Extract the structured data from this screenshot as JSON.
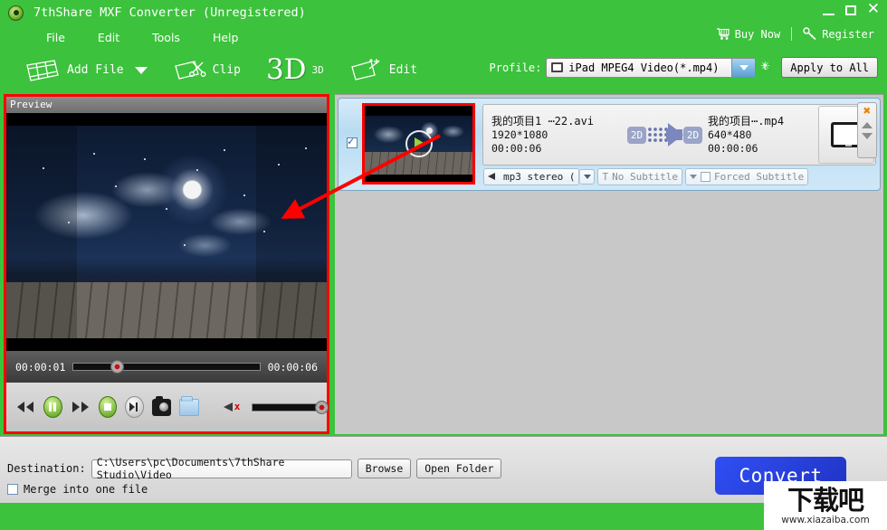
{
  "window": {
    "title": "7thShare MXF Converter (Unregistered)",
    "app_icon": "app-logo-icon",
    "minimize": "—",
    "maximize": "□",
    "close": "✕",
    "title_bar_color": "#3cc23c"
  },
  "menubar": {
    "items": [
      {
        "label": "File"
      },
      {
        "label": "Edit"
      },
      {
        "label": "Tools"
      },
      {
        "label": "Help"
      }
    ]
  },
  "topright": {
    "buy_now": "Buy Now",
    "register": "Register",
    "cart_icon": "shopping-cart-icon",
    "key_icon": "key-icon"
  },
  "toolbar": {
    "add_file": "Add File",
    "clip": "Clip",
    "three_d_big": "3D",
    "three_d_small": "3D",
    "edit": "Edit"
  },
  "profile": {
    "label": "Profile:",
    "value": "iPad MPEG4 Video(*.mp4)",
    "settings_icon": "settings-gear-icon",
    "apply_to_all": "Apply to All"
  },
  "preview": {
    "header": "Preview",
    "current_time": "00:00:01",
    "total_time": "00:00:06",
    "seek_position_pct": 20,
    "volume_pct": 100,
    "muted": true,
    "controls": [
      {
        "name": "rewind-button",
        "glyph": "◀◀"
      },
      {
        "name": "pause-button",
        "glyph": "❙❙"
      },
      {
        "name": "forward-button",
        "glyph": "▶▶"
      },
      {
        "name": "stop-button",
        "glyph": "■"
      },
      {
        "name": "next-frame-button",
        "glyph": "▶❙"
      },
      {
        "name": "snapshot-button",
        "glyph": ""
      },
      {
        "name": "open-folder-button",
        "glyph": ""
      }
    ]
  },
  "filelist": {
    "item": {
      "checked": true,
      "source": {
        "name": "我的项目1 ⋯22.avi",
        "resolution": "1920*1080",
        "duration": "00:00:06",
        "badge": "2D"
      },
      "target": {
        "name": "我的项目⋯.mp4",
        "resolution": "640*480",
        "duration": "00:00:06",
        "badge": "2D"
      },
      "audio_track": "mp3 stereo (",
      "subtitle": "No Subtitle",
      "forced_subtitle": "Forced Subtitle",
      "delete_glyph": "✖"
    }
  },
  "bottom": {
    "destination_label": "Destination:",
    "destination_path": "C:\\Users\\pc\\Documents\\7thShare Studio\\Video",
    "browse": "Browse",
    "open_folder": "Open Folder",
    "merge_label": "Merge into one file",
    "merge_checked": false,
    "convert": "Convert"
  },
  "watermark": {
    "text_cn": "下载吧",
    "url": "www.xiazaiba.com"
  }
}
